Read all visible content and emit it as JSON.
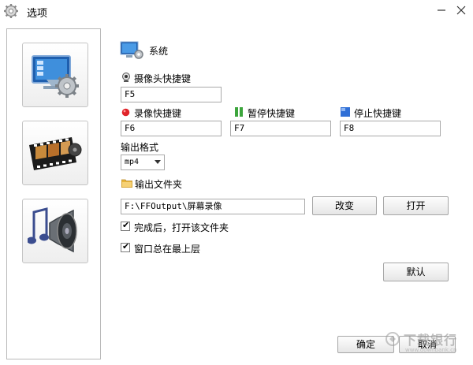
{
  "window": {
    "title": "选项"
  },
  "sidebar": {
    "items": [
      {
        "icon": "system-monitor-gear-icon"
      },
      {
        "icon": "film-reel-icon"
      },
      {
        "icon": "speaker-note-icon"
      }
    ]
  },
  "system": {
    "heading": "系统",
    "camera_hotkey_label": "摄像头快捷键",
    "camera_hotkey_value": "F5",
    "record_hotkey_label": "录像快捷键",
    "record_hotkey_value": "F6",
    "pause_hotkey_label": "暂停快捷键",
    "pause_hotkey_value": "F7",
    "stop_hotkey_label": "停止快捷键",
    "stop_hotkey_value": "F8",
    "format_label": "输出格式",
    "format_value": "mp4",
    "folder_label": "输出文件夹",
    "folder_path": "F:\\FFOutput\\屏幕录像",
    "change_button": "改变",
    "open_button": "打开",
    "open_after_label": "完成后，打开该文件夹",
    "open_after_checked": true,
    "always_on_top_label": "窗口总在最上层",
    "always_on_top_checked": true,
    "default_button": "默认"
  },
  "footer": {
    "ok_button": "确定",
    "cancel_button": "取消"
  },
  "watermark": {
    "text": "下载银行",
    "url": "www.downbank.cn"
  },
  "colors": {
    "record_dot": "#e0242a",
    "pause_icon": "#3ca53c",
    "stop_icon": "#2f6fd6",
    "folder": "#e8b53a"
  }
}
